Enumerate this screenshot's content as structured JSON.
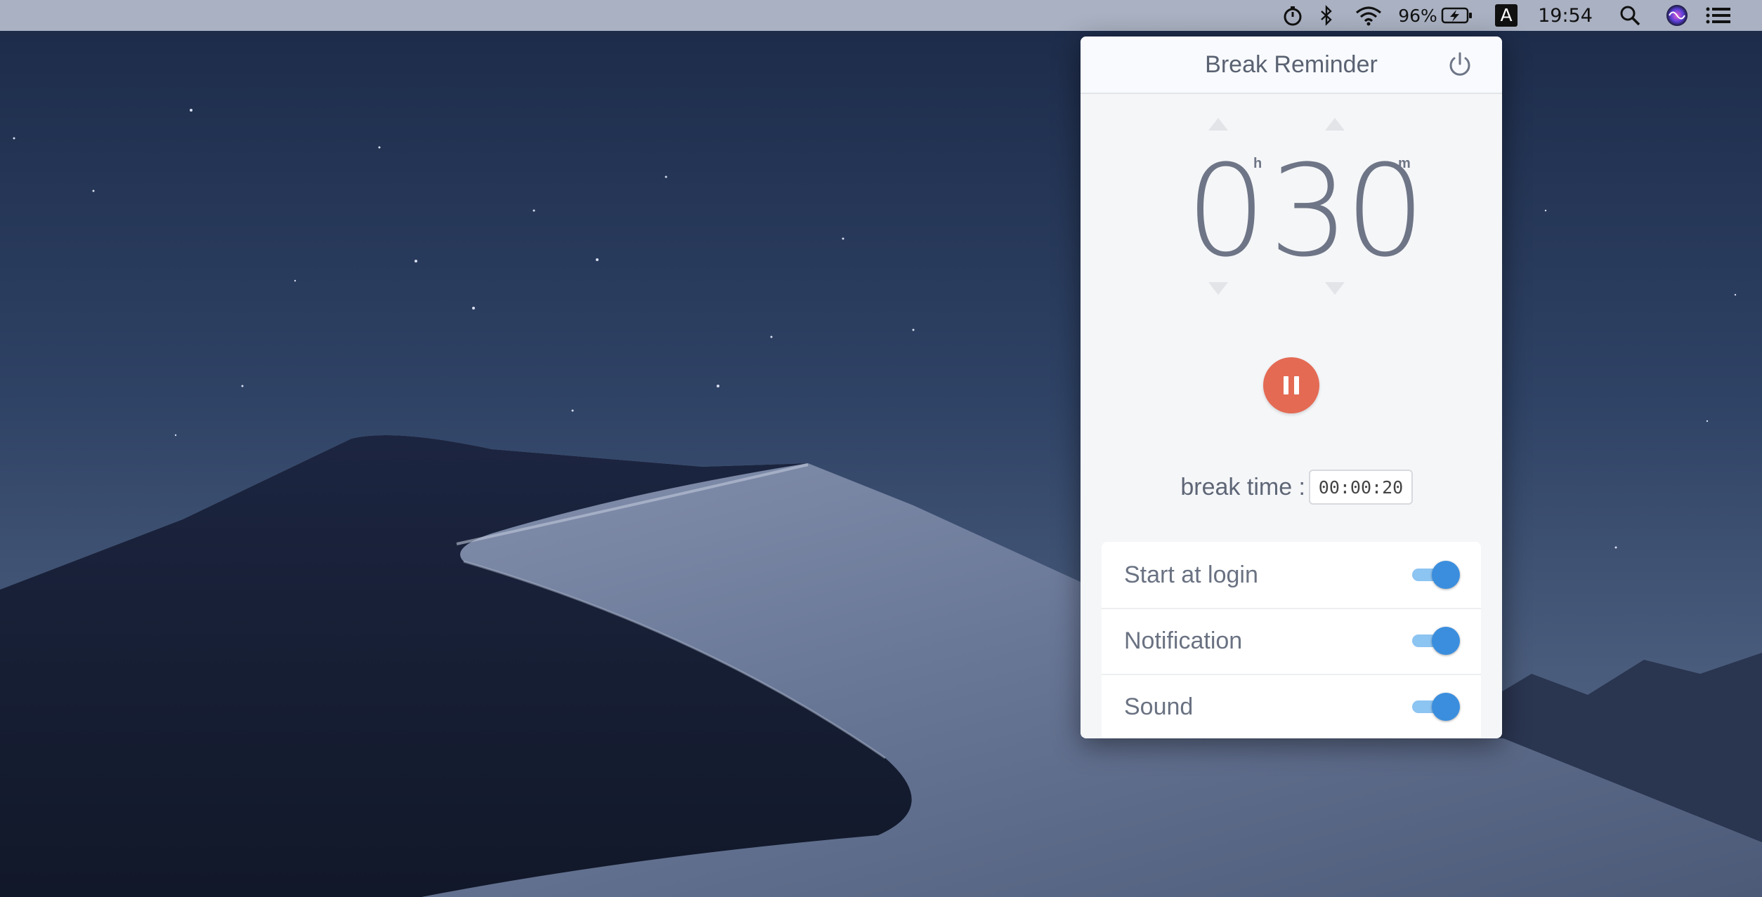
{
  "menubar": {
    "battery_percent": "96%",
    "input_source": "A",
    "clock": "19:54",
    "icons": [
      "stopwatch-icon",
      "bluetooth-icon",
      "wifi-icon",
      "battery-charging-icon",
      "input-source-icon",
      "spotlight-search-icon",
      "siri-icon",
      "notification-center-icon"
    ]
  },
  "popover": {
    "title": "Break Reminder",
    "timer": {
      "hours": "0",
      "hours_unit": "h",
      "minutes": "30",
      "minutes_unit": "m"
    },
    "break_time": {
      "label": "break time :",
      "value": "00:00:20"
    },
    "settings": [
      {
        "label": "Start at login",
        "enabled": true
      },
      {
        "label": "Notification",
        "enabled": true
      },
      {
        "label": "Sound",
        "enabled": true
      }
    ]
  },
  "colors": {
    "accent": "#3b8ede",
    "pause_button": "#e46a54",
    "menubar": "#a9b1c2"
  }
}
